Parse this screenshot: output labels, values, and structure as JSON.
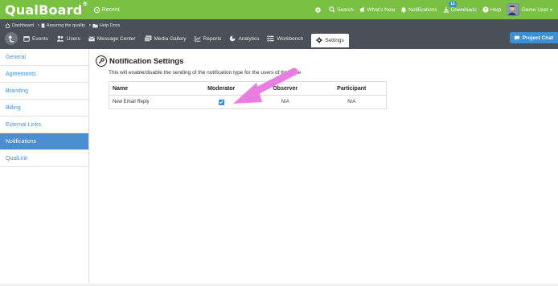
{
  "app": {
    "logo": "QualBoard",
    "logo_mark": "®",
    "recent": "Recent"
  },
  "topnav": {
    "search": "Search",
    "whats_new": "What's New",
    "notifications": "Notifications",
    "notifications_badge": "12",
    "downloads": "Downloads",
    "help": "Help",
    "user": "Demo User"
  },
  "breadcrumb": {
    "items": [
      "Dashboard",
      "Assuring the quality",
      "Help Docs"
    ]
  },
  "tabs": [
    {
      "label": "Events"
    },
    {
      "label": "Users"
    },
    {
      "label": "Message Center"
    },
    {
      "label": "Media Gallery"
    },
    {
      "label": "Reports"
    },
    {
      "label": "Analytics"
    },
    {
      "label": "Workbench"
    },
    {
      "label": "Settings",
      "active": true
    }
  ],
  "project_chat": "Project Chat",
  "sidebar": {
    "items": [
      {
        "label": "General"
      },
      {
        "label": "Agreements"
      },
      {
        "label": "Branding"
      },
      {
        "label": "Billing"
      },
      {
        "label": "External Links"
      },
      {
        "label": "Notifications",
        "active": true
      },
      {
        "label": "QualLink"
      }
    ]
  },
  "main": {
    "title": "Notification Settings",
    "subtitle": "This will enable/disable the sending of the notification type for the users of that type",
    "table": {
      "headers": [
        "Name",
        "Moderator",
        "Observer",
        "Participant"
      ],
      "rows": [
        {
          "name": "New Email Reply",
          "moderator_checked": true,
          "observer": "N/A",
          "participant": "N/A"
        }
      ]
    }
  },
  "colors": {
    "topbar": "#79c142",
    "navbar": "#4a5057",
    "accent": "#4a8ed0",
    "arrow": "#e87ee0"
  }
}
